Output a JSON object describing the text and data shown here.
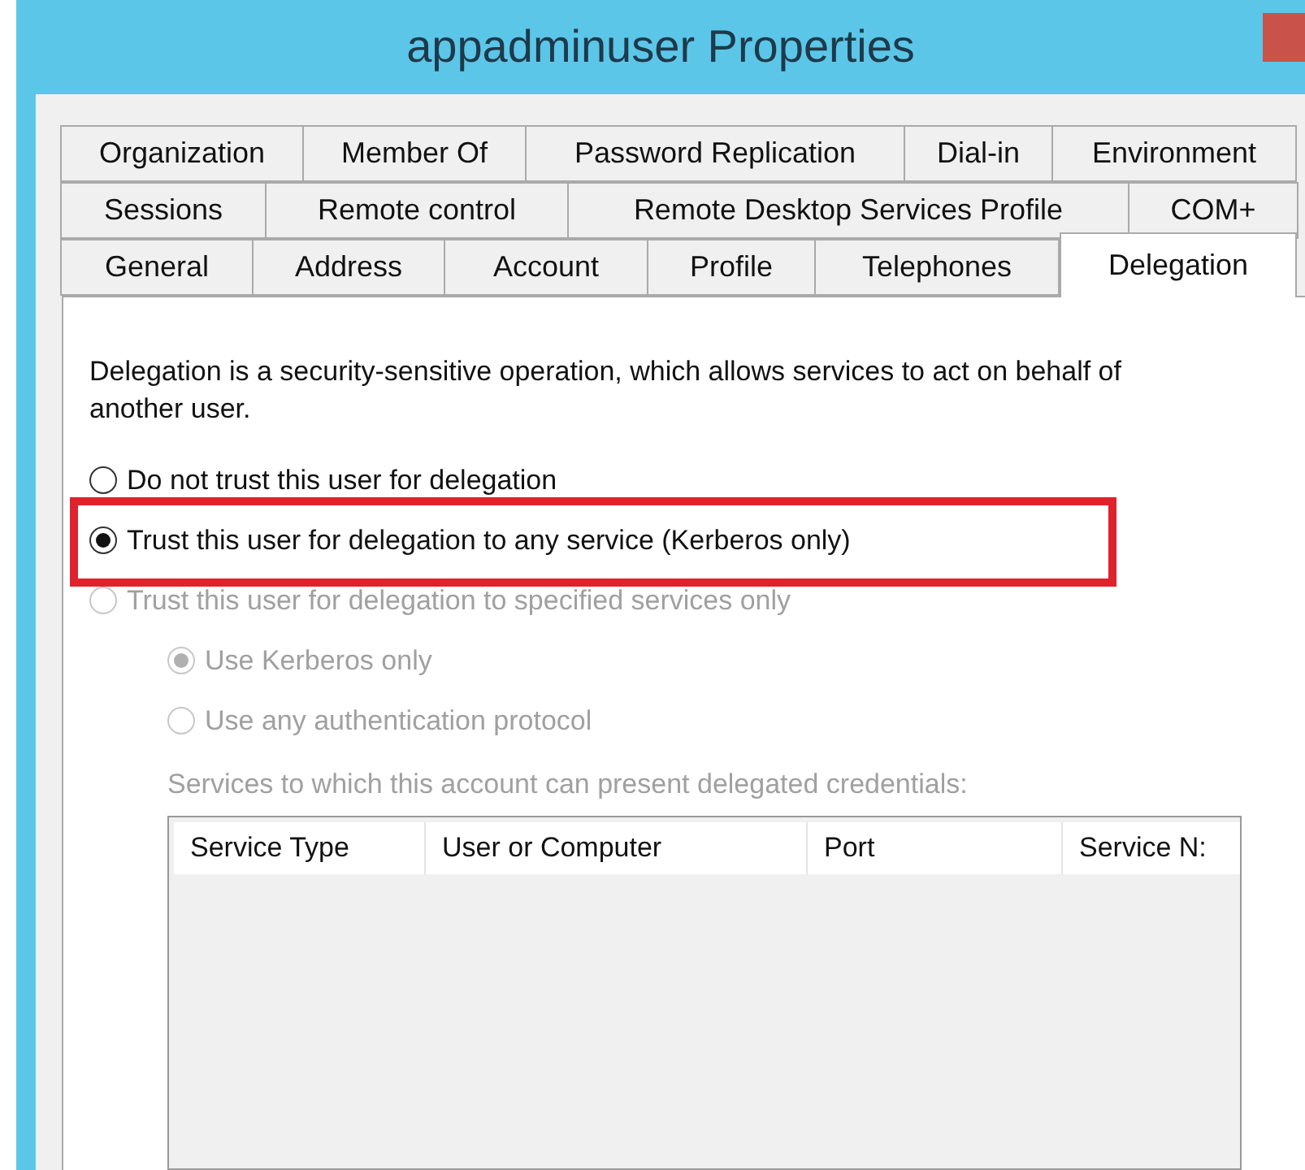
{
  "window": {
    "title": "appadminuser Properties"
  },
  "tab_rows": [
    [
      {
        "label": "Organization",
        "selected": false
      },
      {
        "label": "Member Of",
        "selected": false
      },
      {
        "label": "Password Replication",
        "selected": false
      },
      {
        "label": "Dial-in",
        "selected": false
      },
      {
        "label": "Environment",
        "selected": false
      }
    ],
    [
      {
        "label": "Sessions",
        "selected": false
      },
      {
        "label": "Remote control",
        "selected": false
      },
      {
        "label": "Remote Desktop Services Profile",
        "selected": false
      },
      {
        "label": "COM+",
        "selected": false
      }
    ],
    [
      {
        "label": "General",
        "selected": false
      },
      {
        "label": "Address",
        "selected": false
      },
      {
        "label": "Account",
        "selected": false
      },
      {
        "label": "Profile",
        "selected": false
      },
      {
        "label": "Telephones",
        "selected": false
      },
      {
        "label": "Delegation",
        "selected": true
      }
    ]
  ],
  "description": "Delegation is a security-sensitive operation, which allows services to act on behalf of another user.",
  "options": [
    {
      "label": "Do not trust this user for delegation",
      "selected": false,
      "disabled": false,
      "highlighted": false
    },
    {
      "label": "Trust this user for delegation to any service (Kerberos only)",
      "selected": true,
      "disabled": false,
      "highlighted": true
    },
    {
      "label": "Trust this user for delegation to specified services only",
      "selected": false,
      "disabled": true,
      "highlighted": false,
      "children": [
        {
          "label": "Use Kerberos only",
          "selected": true,
          "disabled": true,
          "highlighted": false
        },
        {
          "label": "Use any authentication protocol",
          "selected": false,
          "disabled": true,
          "highlighted": false
        }
      ]
    }
  ],
  "services_label": "Services to which this account can present delegated credentials:",
  "table": {
    "columns": [
      "Service Type",
      "User or Computer",
      "Port",
      "Service N:"
    ]
  }
}
